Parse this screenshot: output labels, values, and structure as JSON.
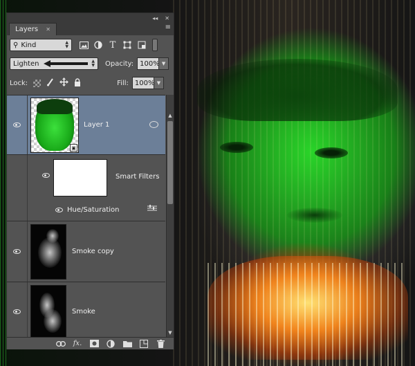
{
  "panel": {
    "collapse_glyph": "◂◂",
    "close_glyph": "✕",
    "tab_label": "Layers",
    "tab_close": "✕",
    "menu_glyph": "≡"
  },
  "filter": {
    "kind_label": "Kind",
    "search_glyph": "⚲",
    "icons": [
      "image-filter-icon",
      "adjustment-filter-icon",
      "type-filter-icon",
      "shape-filter-icon",
      "smart-object-filter-icon"
    ],
    "type_glyph": "T"
  },
  "blend": {
    "mode": "Lighten",
    "opacity_label": "Opacity:",
    "opacity_value": "100%"
  },
  "lock": {
    "label": "Lock:",
    "fill_label": "Fill:",
    "fill_value": "100%"
  },
  "layers": [
    {
      "name": "Layer 1",
      "selected": true,
      "type": "smart-object"
    },
    {
      "name": "Smart Filters",
      "selected": false,
      "type": "smart-filters"
    },
    {
      "name": "Hue/Saturation",
      "selected": false,
      "type": "filter"
    },
    {
      "name": "Smoke copy",
      "selected": false,
      "type": "pixel"
    },
    {
      "name": "Smoke",
      "selected": false,
      "type": "pixel"
    }
  ],
  "bottom_bar": {
    "link_glyph": "⊝",
    "fx_label": "fx.",
    "mask_glyph": "◘",
    "adjust_glyph": "◐",
    "folder_glyph": "▬",
    "new_glyph": "❐",
    "trash_glyph": "🗑"
  },
  "colors": {
    "panel_bg": "#535353",
    "selected_layer": "#6c7f98",
    "header_bg": "#3a3a3a"
  }
}
